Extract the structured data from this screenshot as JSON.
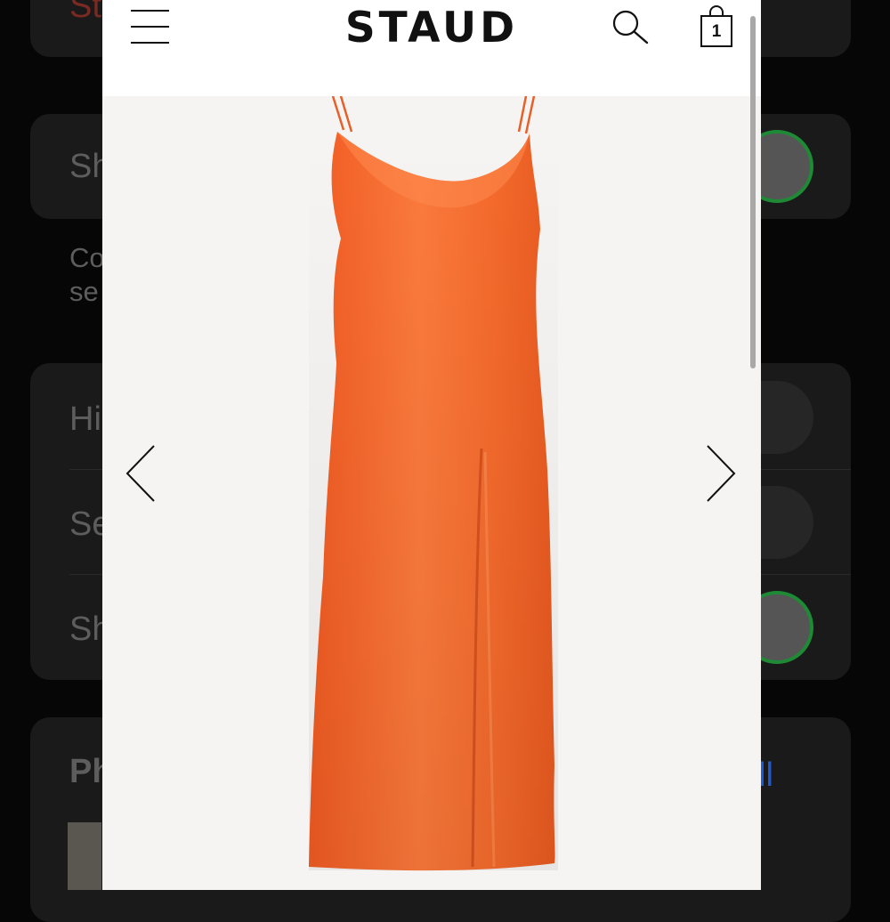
{
  "background_settings": {
    "fragments": [
      "St",
      "Sh",
      "Co",
      "se",
      "Hi",
      "Se",
      "Sh",
      "Ph",
      "ll"
    ],
    "accent_red": "#c0392b",
    "accent_blue": "#1f5bd6",
    "toggle_green": "#1e8a35"
  },
  "header": {
    "logo": "STAUD",
    "bag_count": "1"
  },
  "product": {
    "dress_color": "#f56a30"
  },
  "icons": [
    "hamburger-menu-icon",
    "search-icon",
    "shopping-bag-icon",
    "chevron-left-icon",
    "chevron-right-icon"
  ]
}
